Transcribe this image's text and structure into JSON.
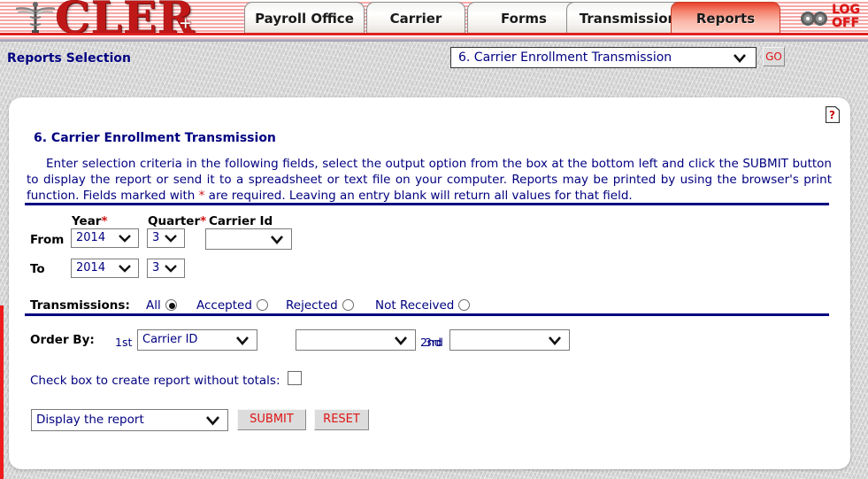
{
  "header": {
    "logo_text": "CLER",
    "logo_plus": "+",
    "caduceus_icon": "caduceus-icon",
    "gears_icon": "gears-icon",
    "logoff_line1": "LOG",
    "logoff_line2": "OFF",
    "tabs": [
      {
        "label": "Payroll Office",
        "active": false
      },
      {
        "label": "Carrier",
        "active": false
      },
      {
        "label": "Forms",
        "active": false
      },
      {
        "label": "Transmission",
        "active": false
      },
      {
        "label": "Reports",
        "active": true
      }
    ]
  },
  "selection_bar": {
    "title": "Reports Selection",
    "report_select_value": "6. Carrier Enrollment Transmission",
    "go_label": "GO"
  },
  "panel": {
    "help_icon": "help-question-icon",
    "title": "6. Carrier Enrollment Transmission",
    "intro_part1": "Enter selection criteria in the following fields, select the output option from the box at the bottom left and click the SUBMIT button to display the report or send it to a spreadsheet or text file on your computer.  Reports may be printed by using the browser's print function.  Fields marked with ",
    "intro_asterisk": "*",
    "intro_part2": " are required.  Leaving an entry blank will return all values for that field.",
    "columns": {
      "year": "Year",
      "quarter": "Quarter",
      "carrier_id": "Carrier Id",
      "required_mark": "*"
    },
    "rows": {
      "from": "From",
      "to": "To"
    },
    "values": {
      "year_from": "2014",
      "year_to": "2014",
      "quarter_from": "3",
      "quarter_to": "3",
      "carrier_id": ""
    },
    "transmissions": {
      "label": "Transmissions:",
      "options": [
        {
          "label": "All",
          "selected": true
        },
        {
          "label": "Accepted",
          "selected": false
        },
        {
          "label": "Rejected",
          "selected": false
        },
        {
          "label": "Not Received",
          "selected": false
        }
      ]
    },
    "order_by": {
      "label": "Order By:",
      "n1": "1st",
      "n2": "2nd",
      "n3": "3rd",
      "value1": "Carrier ID",
      "value2": "",
      "value3": ""
    },
    "checkbox": {
      "label": "Check box to create report without totals:",
      "checked": false
    },
    "output": {
      "value": "Display the report",
      "submit_label": "SUBMIT",
      "reset_label": "RESET"
    }
  },
  "colors": {
    "navy": "#000080",
    "red": "#e01414",
    "brand_red": "#c01818",
    "tab_active": "#f4846f",
    "page_bg": "#d4d4d4"
  }
}
